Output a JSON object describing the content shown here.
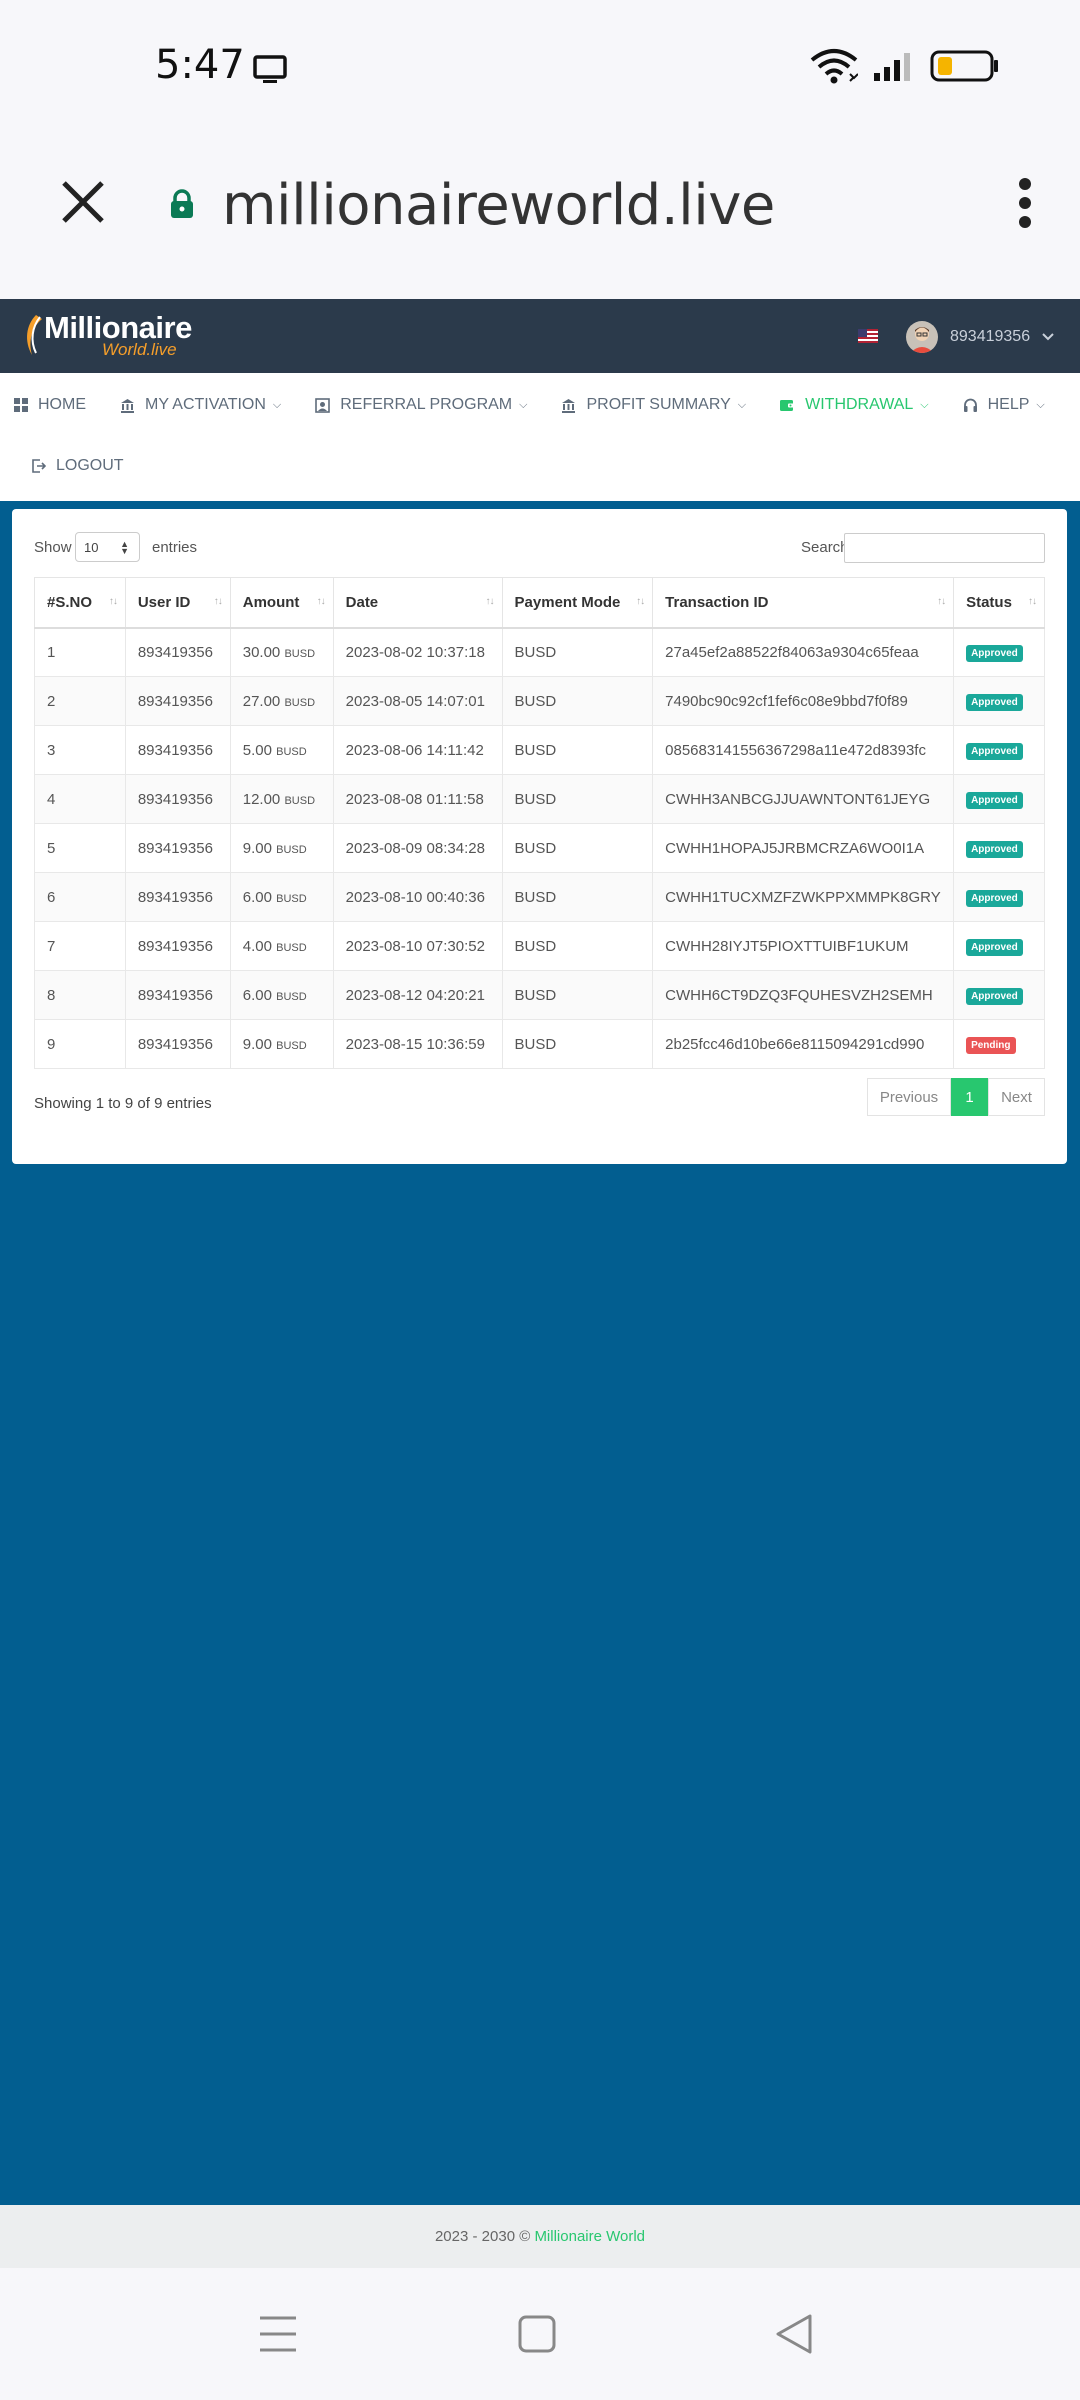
{
  "status_bar": {
    "time": "5:47"
  },
  "browser": {
    "url": "millionaireworld.live"
  },
  "site": {
    "logo_line1": "Millionaire",
    "logo_line2": "World.live",
    "user_id": "893419356"
  },
  "menu": {
    "home": "HOME",
    "activation": "MY ACTIVATION",
    "referral": "REFERRAL PROGRAM",
    "profit": "PROFIT SUMMARY",
    "withdrawal": "WITHDRAWAL",
    "help": "HELP",
    "logout": "LOGOUT",
    "active_color": "#28c76f"
  },
  "table_controls": {
    "show_label": "Show",
    "entries_value": "10",
    "entries_label": "entries",
    "search_label": "Search:",
    "search_value": ""
  },
  "table": {
    "headers": [
      "#S.NO",
      "User ID",
      "Amount",
      "Date",
      "Payment Mode",
      "Transaction ID",
      "Status"
    ],
    "rows": [
      {
        "sno": "1",
        "user_id": "893419356",
        "amount": "30.00",
        "unit": "BUSD",
        "date": "2023-08-02 10:37:18",
        "mode": "BUSD",
        "txid": "27a45ef2a88522f84063a9304c65feaa",
        "status": "Approved"
      },
      {
        "sno": "2",
        "user_id": "893419356",
        "amount": "27.00",
        "unit": "BUSD",
        "date": "2023-08-05 14:07:01",
        "mode": "BUSD",
        "txid": "7490bc90c92cf1fef6c08e9bbd7f0f89",
        "status": "Approved"
      },
      {
        "sno": "3",
        "user_id": "893419356",
        "amount": "5.00",
        "unit": "BUSD",
        "date": "2023-08-06 14:11:42",
        "mode": "BUSD",
        "txid": "085683141556367298a11e472d8393fc",
        "status": "Approved"
      },
      {
        "sno": "4",
        "user_id": "893419356",
        "amount": "12.00",
        "unit": "BUSD",
        "date": "2023-08-08 01:11:58",
        "mode": "BUSD",
        "txid": "CWHH3ANBCGJJUAWNTONT61JEYG",
        "status": "Approved"
      },
      {
        "sno": "5",
        "user_id": "893419356",
        "amount": "9.00",
        "unit": "BUSD",
        "date": "2023-08-09 08:34:28",
        "mode": "BUSD",
        "txid": "CWHH1HOPAJ5JRBMCRZA6WO0I1A",
        "status": "Approved"
      },
      {
        "sno": "6",
        "user_id": "893419356",
        "amount": "6.00",
        "unit": "BUSD",
        "date": "2023-08-10 00:40:36",
        "mode": "BUSD",
        "txid": "CWHH1TUCXMZFZWKPPXMMPK8GRY",
        "status": "Approved"
      },
      {
        "sno": "7",
        "user_id": "893419356",
        "amount": "4.00",
        "unit": "BUSD",
        "date": "2023-08-10 07:30:52",
        "mode": "BUSD",
        "txid": "CWHH28IYJT5PIOXTTUIBF1UKUM",
        "status": "Approved"
      },
      {
        "sno": "8",
        "user_id": "893419356",
        "amount": "6.00",
        "unit": "BUSD",
        "date": "2023-08-12 04:20:21",
        "mode": "BUSD",
        "txid": "CWHH6CT9DZQ3FQUHESVZH2SEMH",
        "status": "Approved"
      },
      {
        "sno": "9",
        "user_id": "893419356",
        "amount": "9.00",
        "unit": "BUSD",
        "date": "2023-08-15 10:36:59",
        "mode": "BUSD",
        "txid": "2b25fcc46d10be66e8115094291cd990",
        "status": "Pending"
      }
    ],
    "status_colors": {
      "Approved": "#1aa89a",
      "Pending": "#ea5455"
    }
  },
  "table_footer": {
    "info": "Showing 1 to 9 of 9 entries",
    "prev": "Previous",
    "page": "1",
    "next": "Next"
  },
  "footer": {
    "copyright": "2023 - 2030 ©",
    "brand": "Millionaire World"
  },
  "colors": {
    "main_bg": "#025e90",
    "header_bg": "#2b3a4b",
    "accent": "#28c76f"
  }
}
